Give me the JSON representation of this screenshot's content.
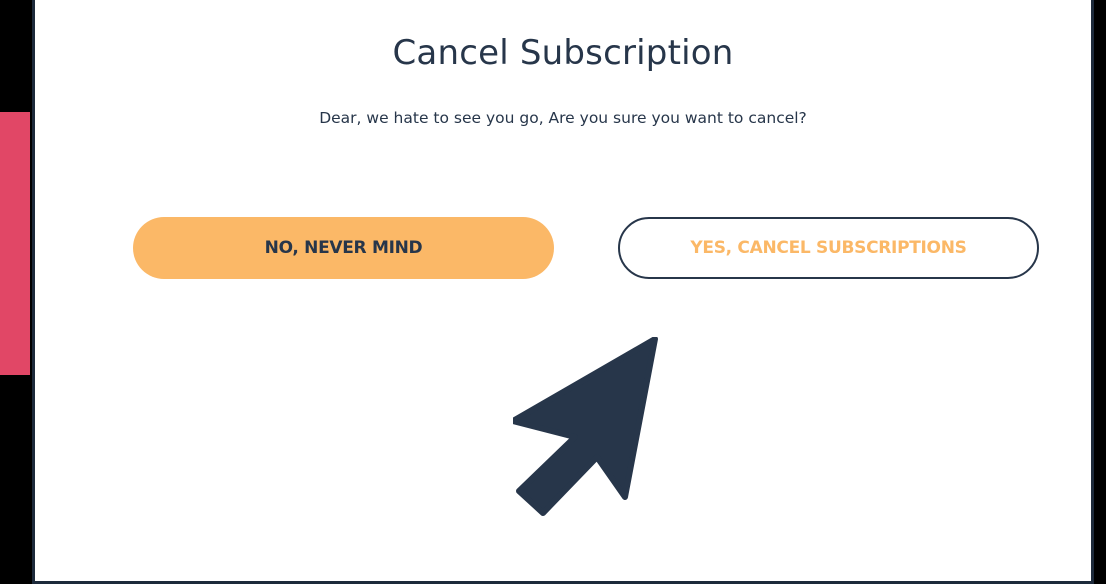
{
  "colors": {
    "accent": "#e14766",
    "primary_button": "#fbb867",
    "text_dark": "#27364a",
    "border": "#1d2a3b"
  },
  "dialog": {
    "title": "Cancel Subscription",
    "message": "Dear, we hate to see you go, Are you sure you want to cancel?",
    "keep_button_label": "NO, NEVER MIND",
    "cancel_button_label": "YES, CANCEL SUBSCRIPTIONS"
  },
  "icons": {
    "pointer": "mouse-pointer-arrow-icon"
  }
}
